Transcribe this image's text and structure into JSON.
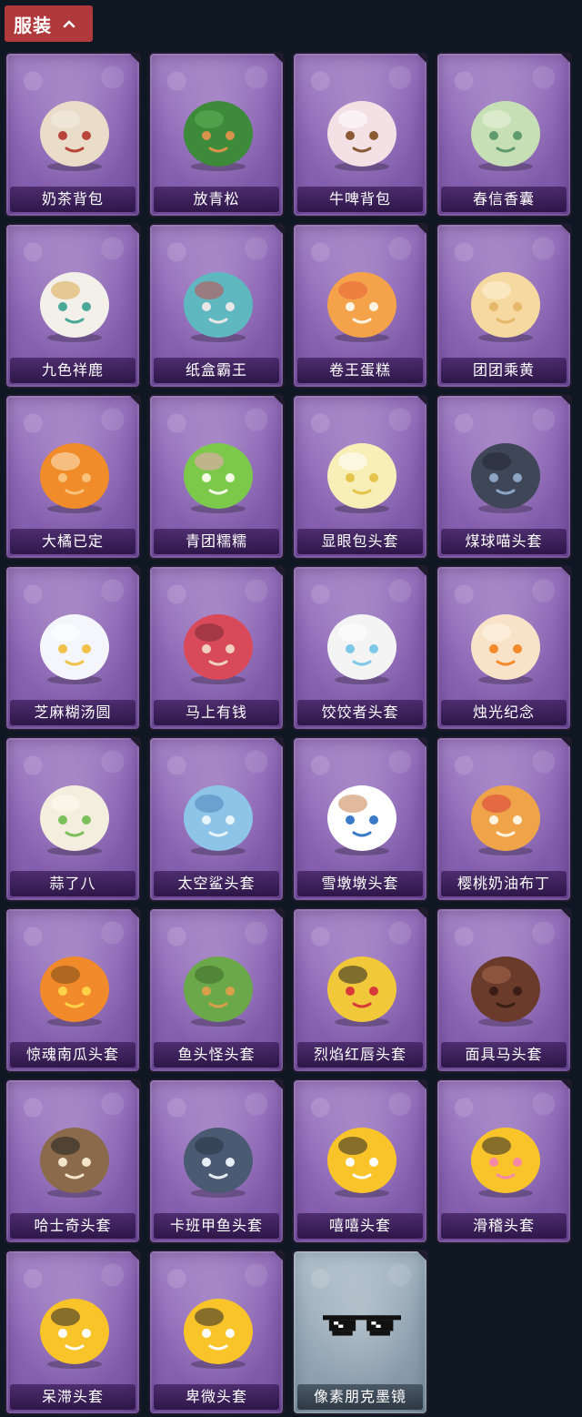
{
  "section": {
    "title": "服装"
  },
  "items": [
    {
      "label": "奶茶背包",
      "icon": "milk-tea-backpack-icon",
      "colors": [
        "#e9dcc8",
        "#b8443a",
        "#f5efe4"
      ]
    },
    {
      "label": "放青松",
      "icon": "bonsai-pine-icon",
      "colors": [
        "#3c8a3a",
        "#d9924a",
        "#5fb55a"
      ]
    },
    {
      "label": "牛啤背包",
      "icon": "cow-beer-backpack-icon",
      "colors": [
        "#f4e1e6",
        "#8a5a34",
        "#ffffff"
      ]
    },
    {
      "label": "春信香囊",
      "icon": "sachet-icon",
      "colors": [
        "#c7dfb5",
        "#5f9a6f",
        "#e9f3dc"
      ]
    },
    {
      "label": "九色祥鹿",
      "icon": "deer-icon",
      "colors": [
        "#f3efe9",
        "#49a896",
        "#d9a84a"
      ]
    },
    {
      "label": "纸盒霸王",
      "icon": "box-dinosaur-icon",
      "colors": [
        "#5fb8c0",
        "#e7e7e7",
        "#c84a4a"
      ]
    },
    {
      "label": "卷王蛋糕",
      "icon": "roll-cake-icon",
      "colors": [
        "#f5a34a",
        "#fff4e4",
        "#e5623a"
      ]
    },
    {
      "label": "团团乘黄",
      "icon": "yellow-cat-icon",
      "colors": [
        "#f5d9a0",
        "#e5b86a",
        "#fff2d8"
      ]
    },
    {
      "label": "大橘已定",
      "icon": "orange-icon",
      "colors": [
        "#f08c2a",
        "#f8c27a",
        "#ffe8c4"
      ]
    },
    {
      "label": "青团糯糯",
      "icon": "green-dumpling-icon",
      "colors": [
        "#7cc84a",
        "#f3fbe6",
        "#f4a8c0"
      ]
    },
    {
      "label": "显眼包头套",
      "icon": "lightbulb-head-icon",
      "colors": [
        "#f8eeb8",
        "#e5c44a",
        "#ffffff"
      ]
    },
    {
      "label": "煤球喵头套",
      "icon": "black-cat-head-icon",
      "colors": [
        "#3e4658",
        "#8ea4c4",
        "#222833"
      ]
    },
    {
      "label": "芝麻糊汤圆",
      "icon": "rice-ball-icon",
      "colors": [
        "#f4f6fb",
        "#f0c24a",
        "#ffffff"
      ]
    },
    {
      "label": "马上有钱",
      "icon": "red-horse-head-icon",
      "colors": [
        "#d84a5a",
        "#f0d0c0",
        "#7a2a34"
      ]
    },
    {
      "label": "饺饺者头套",
      "icon": "dumpling-head-icon",
      "colors": [
        "#f4f4f4",
        "#7ec8e8",
        "#ffffff"
      ]
    },
    {
      "label": "烛光纪念",
      "icon": "candle-head-icon",
      "colors": [
        "#f8e2c8",
        "#f58a2a",
        "#fff6ea"
      ]
    },
    {
      "label": "蒜了八",
      "icon": "garlic-head-icon",
      "colors": [
        "#f4eedf",
        "#7cc05a",
        "#fffaf0"
      ]
    },
    {
      "label": "太空鲨头套",
      "icon": "shark-head-icon",
      "colors": [
        "#8ec4e8",
        "#e8f4fb",
        "#4a86b8"
      ]
    },
    {
      "label": "雪墩墩头套",
      "icon": "snowman-head-icon",
      "colors": [
        "#ffffff",
        "#3a7ac8",
        "#c8804a"
      ]
    },
    {
      "label": "樱桃奶油布丁",
      "icon": "pudding-head-icon",
      "colors": [
        "#f0a44a",
        "#fff4e0",
        "#d83a3a"
      ]
    },
    {
      "label": "惊魂南瓜头套",
      "icon": "pumpkin-head-icon",
      "colors": [
        "#f08a2a",
        "#ffd24a",
        "#7a4a1a"
      ]
    },
    {
      "label": "鱼头怪头套",
      "icon": "fish-mask-icon",
      "colors": [
        "#6aa84a",
        "#d8a04a",
        "#3c6a2a"
      ]
    },
    {
      "label": "烈焰红唇头套",
      "icon": "yellow-mouse-mask-icon",
      "colors": [
        "#f0c83a",
        "#d83a3a",
        "#222222"
      ]
    },
    {
      "label": "面具马头套",
      "icon": "horse-mask-icon",
      "colors": [
        "#6a3a2a",
        "#3a1e16",
        "#a86a4a"
      ]
    },
    {
      "label": "哈士奇头套",
      "icon": "husky-mask-icon",
      "colors": [
        "#8a6a4a",
        "#f4e4cc",
        "#222222"
      ]
    },
    {
      "label": "卡班甲鱼头套",
      "icon": "fish-head-icon",
      "colors": [
        "#4a5a72",
        "#e8eef6",
        "#2a3444"
      ]
    },
    {
      "label": "嘻嘻头套",
      "icon": "grin-emoji-head-icon",
      "colors": [
        "#f8c42a",
        "#ffffff",
        "#2a2a2a"
      ]
    },
    {
      "label": "滑稽头套",
      "icon": "smirk-emoji-head-icon",
      "colors": [
        "#f8c42a",
        "#f48aa8",
        "#2a2a2a"
      ]
    },
    {
      "label": "呆滞头套",
      "icon": "dazed-emoji-head-icon",
      "colors": [
        "#f8c42a",
        "#ffffff",
        "#2a2a2a"
      ]
    },
    {
      "label": "卑微头套",
      "icon": "pleading-emoji-head-icon",
      "colors": [
        "#f8c42a",
        "#ffffff",
        "#2a2a2a"
      ]
    },
    {
      "label": "像素朋克墨镜",
      "icon": "pixel-sunglasses-icon",
      "colors": [
        "#111111",
        "#ffffff",
        "#333333"
      ],
      "theme": "gray"
    }
  ]
}
